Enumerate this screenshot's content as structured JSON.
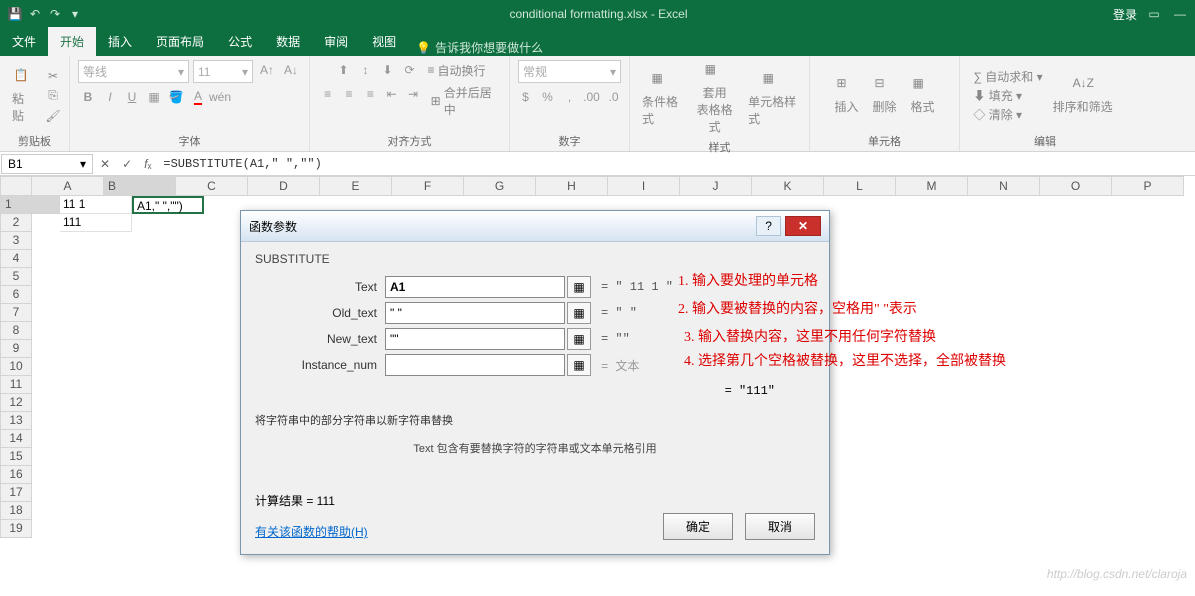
{
  "titlebar": {
    "title": "conditional formatting.xlsx - Excel",
    "login": "登录"
  },
  "tabs": {
    "file": "文件",
    "home": "开始",
    "insert": "插入",
    "layout": "页面布局",
    "formulas": "公式",
    "data": "数据",
    "review": "审阅",
    "view": "视图",
    "tellme": "告诉我你想要做什么"
  },
  "ribbon": {
    "clipboard": {
      "label": "剪贴板",
      "paste": "粘贴"
    },
    "font": {
      "label": "字体",
      "name": "等线",
      "size": "11"
    },
    "align": {
      "label": "对齐方式",
      "wrap": "自动换行",
      "merge": "合并后居中"
    },
    "number": {
      "label": "数字",
      "format": "常规"
    },
    "styles": {
      "label": "样式",
      "cond": "条件格式",
      "table": "套用\n表格格式",
      "cell": "单元格样式"
    },
    "cells": {
      "label": "单元格",
      "insert": "插入",
      "delete": "删除",
      "format": "格式"
    },
    "editing": {
      "label": "编辑",
      "sum": "自动求和",
      "fill": "填充",
      "clear": "清除",
      "sort": "排序和筛选"
    }
  },
  "namebox": "B1",
  "formula": "=SUBSTITUTE(A1,\" \",\"\")",
  "columns": [
    "A",
    "B",
    "C",
    "D",
    "E",
    "F",
    "G",
    "H",
    "I",
    "J",
    "K",
    "L",
    "M",
    "N",
    "O",
    "P"
  ],
  "rows": [
    "1",
    "2",
    "3",
    "4",
    "5",
    "6",
    "7",
    "8",
    "9",
    "10",
    "11",
    "12",
    "13",
    "14",
    "15",
    "16",
    "17",
    "18",
    "19"
  ],
  "sheet": {
    "A1": "11 1",
    "B1": "A1,\" \",\"\")",
    "A2": "111"
  },
  "dialog": {
    "title": "函数参数",
    "func": "SUBSTITUTE",
    "params": {
      "text": {
        "label": "Text",
        "value": "A1",
        "eq": "= \" 11 1 \""
      },
      "old": {
        "label": "Old_text",
        "value": "\" \"",
        "eq": "= \" \""
      },
      "new": {
        "label": "New_text",
        "value": "\"\"",
        "eq": "= \"\""
      },
      "inst": {
        "label": "Instance_num",
        "value": "",
        "eq": "= 文本"
      }
    },
    "result_eq": "= \"111\"",
    "desc": "将字符串中的部分字符串以新字符串替换",
    "desc2": "Text  包含有要替换字符的字符串或文本单元格引用",
    "calc": "计算结果 =  111",
    "help": "有关该函数的帮助(H)",
    "ok": "确定",
    "cancel": "取消"
  },
  "anno": {
    "l1": "1. 输入要处理的单元格",
    "l2": "2. 输入要被替换的内容，空格用\" \"表示",
    "l3": "3. 输入替换内容，这里不用任何字符替换",
    "l4": "4. 选择第几个空格被替换，这里不选择，全部被替换"
  },
  "watermark": "http://blog.csdn.net/claroja"
}
